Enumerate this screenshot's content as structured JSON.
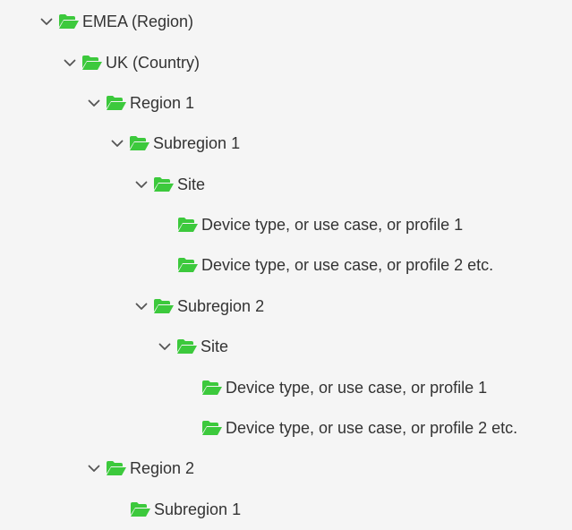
{
  "tree": {
    "nodes": [
      {
        "label": "EMEA (Region)",
        "expanded": true,
        "has_children": true,
        "icon": "folder-open-icon"
      },
      {
        "label": "UK (Country)",
        "expanded": true,
        "has_children": true,
        "icon": "folder-open-icon"
      },
      {
        "label": "Region 1",
        "expanded": true,
        "has_children": true,
        "icon": "folder-open-icon"
      },
      {
        "label": "Subregion 1",
        "expanded": true,
        "has_children": true,
        "icon": "folder-open-icon"
      },
      {
        "label": "Site",
        "expanded": true,
        "has_children": true,
        "icon": "folder-open-icon"
      },
      {
        "label": "Device type, or use case, or profile 1",
        "expanded": false,
        "has_children": false,
        "icon": "folder-open-icon"
      },
      {
        "label": "Device type, or use case, or profile 2 etc.",
        "expanded": false,
        "has_children": false,
        "icon": "folder-open-icon"
      },
      {
        "label": "Subregion 2",
        "expanded": true,
        "has_children": true,
        "icon": "folder-open-icon"
      },
      {
        "label": "Site",
        "expanded": true,
        "has_children": true,
        "icon": "folder-open-icon"
      },
      {
        "label": "Device type, or use case, or profile 1",
        "expanded": false,
        "has_children": false,
        "icon": "folder-open-icon"
      },
      {
        "label": "Device type, or use case, or profile 2 etc.",
        "expanded": false,
        "has_children": false,
        "icon": "folder-open-icon"
      },
      {
        "label": "Region 2",
        "expanded": true,
        "has_children": true,
        "icon": "folder-open-icon"
      },
      {
        "label": "Subregion 1",
        "expanded": false,
        "has_children": false,
        "icon": "folder-open-icon"
      }
    ]
  },
  "colors": {
    "folder": "#3cc93c",
    "text": "#333333",
    "chevron": "#555555",
    "background": "#f5f5f5"
  }
}
